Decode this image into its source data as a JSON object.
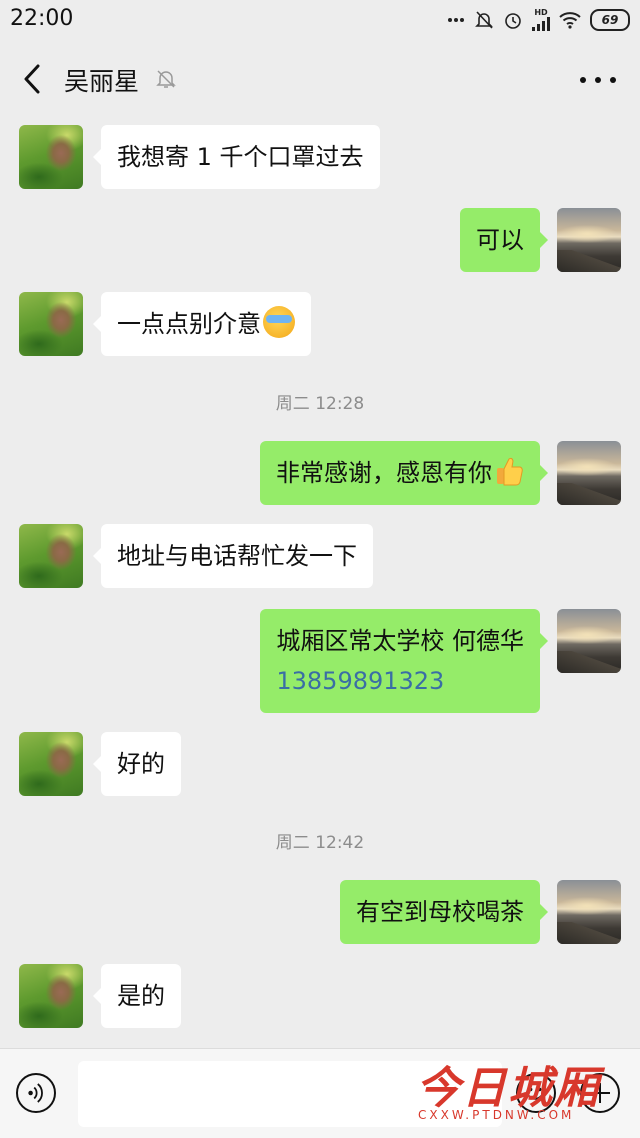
{
  "status_bar": {
    "time": "22:00",
    "battery": "69",
    "hd_label": "HD",
    "icons": [
      "dots-icon",
      "mute-icon",
      "alarm-icon",
      "signal-icon",
      "wifi-icon",
      "battery-icon"
    ]
  },
  "header": {
    "title": "吴丽星",
    "back_icon": "chevron-left-icon",
    "mute_icon": "bell-off-icon",
    "more_icon": "more-dots-icon"
  },
  "messages": [
    {
      "side": "in",
      "text": "我想寄 1 千个口罩过去"
    },
    {
      "side": "out",
      "text": "可以"
    },
    {
      "side": "in",
      "text": "一点点别介意",
      "emoji": "crying-laughing-emoji"
    },
    {
      "type": "time",
      "text": "周二 12:28"
    },
    {
      "side": "out",
      "text": "非常感谢，感恩有你",
      "emoji": "thumbs-up-emoji"
    },
    {
      "side": "in",
      "text": "地址与电话帮忙发一下"
    },
    {
      "side": "out",
      "text": "城厢区常太学校  何德华",
      "phone": "13859891323"
    },
    {
      "side": "in",
      "text": "好的"
    },
    {
      "type": "time",
      "text": "周二 12:42"
    },
    {
      "side": "out",
      "text": "有空到母校喝茶"
    },
    {
      "side": "in",
      "text": "是的"
    }
  ],
  "input_bar": {
    "voice_icon": "voice-icon",
    "emoji_icon": "emoji-icon",
    "plus_icon": "plus-icon",
    "placeholder": ""
  },
  "watermark": {
    "title": "今日城厢",
    "url": "CXXW.PTDNW.COM"
  },
  "colors": {
    "background": "#ededed",
    "bubble_out": "#95ec69",
    "bubble_in": "#ffffff",
    "phone_link": "#3a6ea5",
    "watermark": "#d8382c"
  }
}
